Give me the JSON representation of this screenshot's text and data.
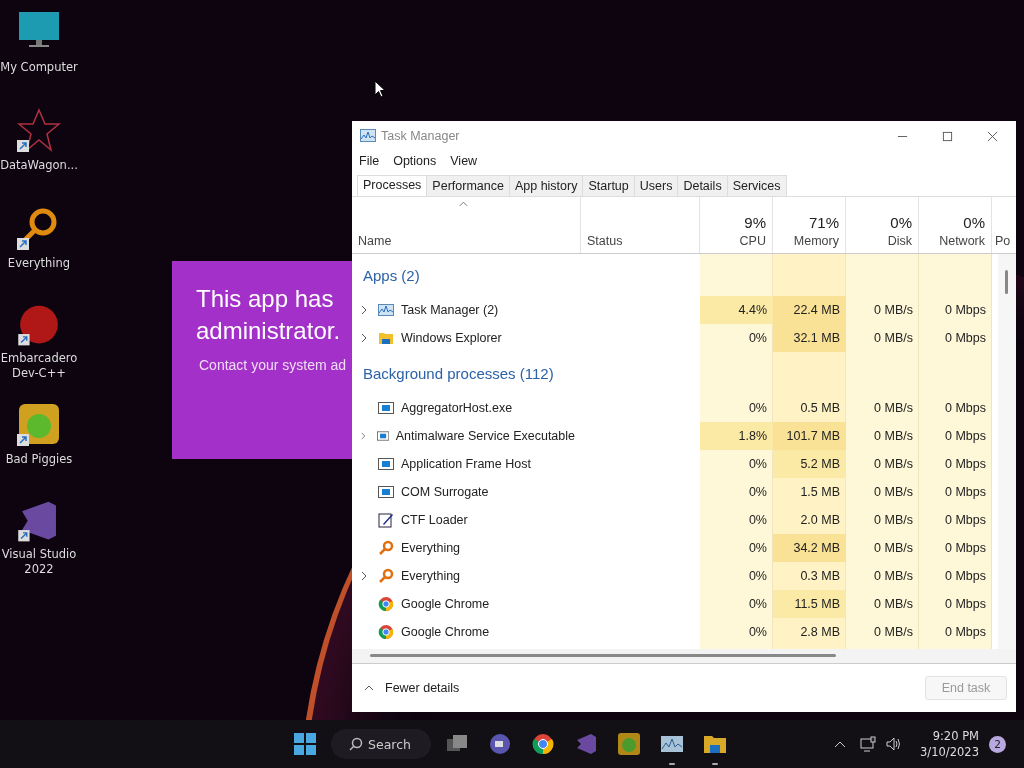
{
  "desktop_icons": [
    {
      "label": "My Computer",
      "kind": "monitor",
      "shortcut": false
    },
    {
      "label": "DataWagon...",
      "kind": "star",
      "shortcut": true
    },
    {
      "label": "Everything",
      "kind": "magnifier",
      "shortcut": true
    },
    {
      "label": "Embarcadero Dev-C++",
      "kind": "devcpp",
      "shortcut": true
    },
    {
      "label": "Bad Piggies",
      "kind": "piggy",
      "shortcut": true
    },
    {
      "label": "Visual Studio 2022",
      "kind": "vs",
      "shortcut": true
    }
  ],
  "dialog": {
    "title_lines": [
      "This app has",
      "administrator."
    ],
    "message": "Contact your system ad"
  },
  "window": {
    "title": "Task Manager",
    "menu": [
      "File",
      "Options",
      "View"
    ],
    "tabs": [
      {
        "label": "Processes",
        "selected": true
      },
      {
        "label": "Performance",
        "selected": false
      },
      {
        "label": "App history",
        "selected": false
      },
      {
        "label": "Startup",
        "selected": false
      },
      {
        "label": "Users",
        "selected": false
      },
      {
        "label": "Details",
        "selected": false
      },
      {
        "label": "Services",
        "selected": false
      }
    ],
    "columns": [
      {
        "label": "Name"
      },
      {
        "label": "Status"
      },
      {
        "label": "CPU",
        "total": "9%"
      },
      {
        "label": "Memory",
        "total": "71%"
      },
      {
        "label": "Disk",
        "total": "0%"
      },
      {
        "label": "Network",
        "total": "0%"
      },
      {
        "label": "Po"
      }
    ],
    "groups": [
      {
        "title": "Apps (2)",
        "rows": [
          {
            "name": "Task Manager (2)",
            "kind": "taskmgr",
            "expandable": true,
            "cpu": "4.4%",
            "memory": "22.4 MB",
            "disk": "0 MB/s",
            "network": "0 Mbps"
          },
          {
            "name": "Windows Explorer",
            "kind": "folder",
            "expandable": true,
            "cpu": "0%",
            "memory": "32.1 MB",
            "disk": "0 MB/s",
            "network": "0 Mbps"
          }
        ]
      },
      {
        "title": "Background processes (112)",
        "rows": [
          {
            "name": "AggregatorHost.exe",
            "kind": "service",
            "expandable": false,
            "cpu": "0%",
            "memory": "0.5 MB",
            "disk": "0 MB/s",
            "network": "0 Mbps"
          },
          {
            "name": "Antimalware Service Executable",
            "kind": "service",
            "expandable": true,
            "cpu": "1.8%",
            "memory": "101.7 MB",
            "disk": "0 MB/s",
            "network": "0 Mbps"
          },
          {
            "name": "Application Frame Host",
            "kind": "service",
            "expandable": false,
            "cpu": "0%",
            "memory": "5.2 MB",
            "disk": "0 MB/s",
            "network": "0 Mbps"
          },
          {
            "name": "COM Surrogate",
            "kind": "service",
            "expandable": false,
            "cpu": "0%",
            "memory": "1.5 MB",
            "disk": "0 MB/s",
            "network": "0 Mbps"
          },
          {
            "name": "CTF Loader",
            "kind": "pen",
            "expandable": false,
            "cpu": "0%",
            "memory": "2.0 MB",
            "disk": "0 MB/s",
            "network": "0 Mbps"
          },
          {
            "name": "Everything",
            "kind": "magnifier",
            "expandable": false,
            "cpu": "0%",
            "memory": "34.2 MB",
            "disk": "0 MB/s",
            "network": "0 Mbps"
          },
          {
            "name": "Everything",
            "kind": "magnifier",
            "expandable": true,
            "cpu": "0%",
            "memory": "0.3 MB",
            "disk": "0 MB/s",
            "network": "0 Mbps"
          },
          {
            "name": "Google Chrome",
            "kind": "chrome",
            "expandable": false,
            "cpu": "0%",
            "memory": "11.5 MB",
            "disk": "0 MB/s",
            "network": "0 Mbps"
          },
          {
            "name": "Google Chrome",
            "kind": "chrome",
            "expandable": false,
            "cpu": "0%",
            "memory": "2.8 MB",
            "disk": "0 MB/s",
            "network": "0 Mbps"
          }
        ]
      }
    ],
    "footer": {
      "toggle": "Fewer details",
      "end_task": {
        "label": "End task",
        "disabled": true
      }
    }
  },
  "taskbar": {
    "search": "Search",
    "apps": [
      {
        "kind": "taskview",
        "running": false
      },
      {
        "kind": "chat",
        "running": false
      },
      {
        "kind": "chrome",
        "running": false
      },
      {
        "kind": "vs",
        "running": false
      },
      {
        "kind": "piggy",
        "running": false
      },
      {
        "kind": "taskmgr",
        "running": true
      },
      {
        "kind": "folder",
        "running": true
      }
    ],
    "time": "9:20 PM",
    "date": "3/10/2023",
    "notifications": "2"
  }
}
